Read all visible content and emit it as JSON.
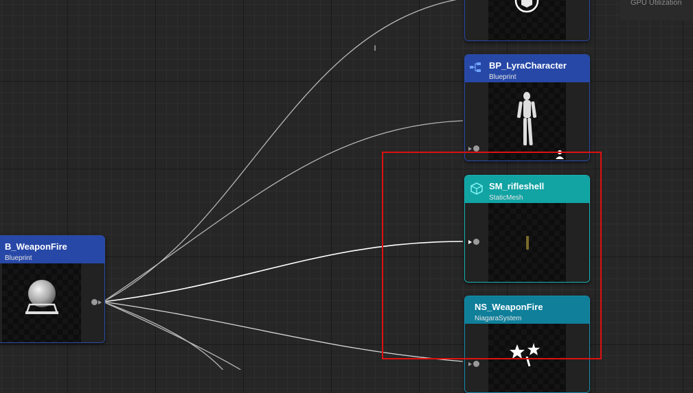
{
  "overlay": {
    "gpu_label": "GPU Utilization"
  },
  "nodes": {
    "top": {
      "title": "",
      "subtitle": "",
      "color": "#1f3a8a"
    },
    "bp_lyra": {
      "title": "BP_LyraCharacter",
      "subtitle": "Blueprint",
      "color": "#2748a7"
    },
    "sm_rifleshell": {
      "title": "SM_rifleshell",
      "subtitle": "StaticMesh",
      "color": "#12a3a3"
    },
    "ns_weaponfire": {
      "title": "NS_WeaponFire",
      "subtitle": "NiagaraSystem",
      "color": "#0f7f9a"
    },
    "b_weaponfire": {
      "title": "B_WeaponFire",
      "subtitle": "Blueprint",
      "color": "#2748a7"
    }
  },
  "colors": {
    "highlight": "#e01010",
    "wire": "#c8c8c8",
    "grid_bg": "#262626"
  },
  "icons": {
    "top": "cube-asset-icon",
    "bp_lyra": "blueprint-graph-icon",
    "sm_rifleshell": "static-mesh-cube-icon",
    "ns_weaponfire": "niagara-icon"
  }
}
